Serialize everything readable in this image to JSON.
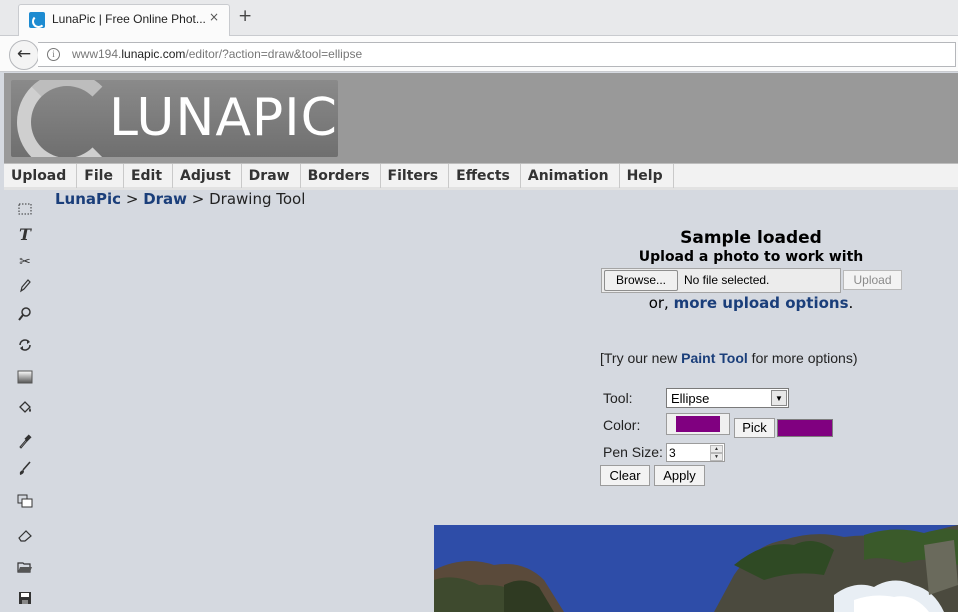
{
  "browser": {
    "tab_title": "LunaPic | Free Online Phot...",
    "tab_close": "×",
    "new_tab": "+",
    "url_prefix": "www194.",
    "url_domain": "lunapic.com",
    "url_path": "/editor/?action=draw&tool=ellipse"
  },
  "header": {
    "logo_text": "LUNAPIC"
  },
  "menu": [
    "Upload",
    "File",
    "Edit",
    "Adjust",
    "Draw",
    "Borders",
    "Filters",
    "Effects",
    "Animation",
    "Help"
  ],
  "breadcrumb": {
    "home": "LunaPic",
    "sep1": " > ",
    "section": "Draw",
    "sep2": " > ",
    "current": "Drawing Tool"
  },
  "upload": {
    "title": "Sample loaded",
    "subtitle": "Upload a photo to work with",
    "browse_label": "Browse...",
    "file_status": "No file selected.",
    "upload_label": "Upload",
    "more_prefix": "or, ",
    "more_link": "more upload options",
    "more_suffix": "."
  },
  "paint_tool": {
    "prefix": "[Try our new ",
    "link": "Paint Tool",
    "suffix": " for more options)"
  },
  "form": {
    "tool_label": "Tool:",
    "tool_value": "Ellipse",
    "color_label": "Color:",
    "pick_label": "Pick",
    "pen_size_label": "Pen Size:",
    "pen_size_value": "3",
    "clear_label": "Clear",
    "apply_label": "Apply"
  },
  "colors": {
    "selected_color": "#800080",
    "link_color": "#1a3e7a",
    "page_bg": "#d5d9e0"
  },
  "toolbar_icons": [
    "selection-icon",
    "text-icon",
    "scissors-icon",
    "pencil-icon",
    "magnifier-icon",
    "rotate-icon",
    "gradient-icon",
    "paint-bucket-icon",
    "eyedropper-icon",
    "brush-icon",
    "layers-icon",
    "eraser-icon",
    "open-folder-icon",
    "save-icon"
  ]
}
